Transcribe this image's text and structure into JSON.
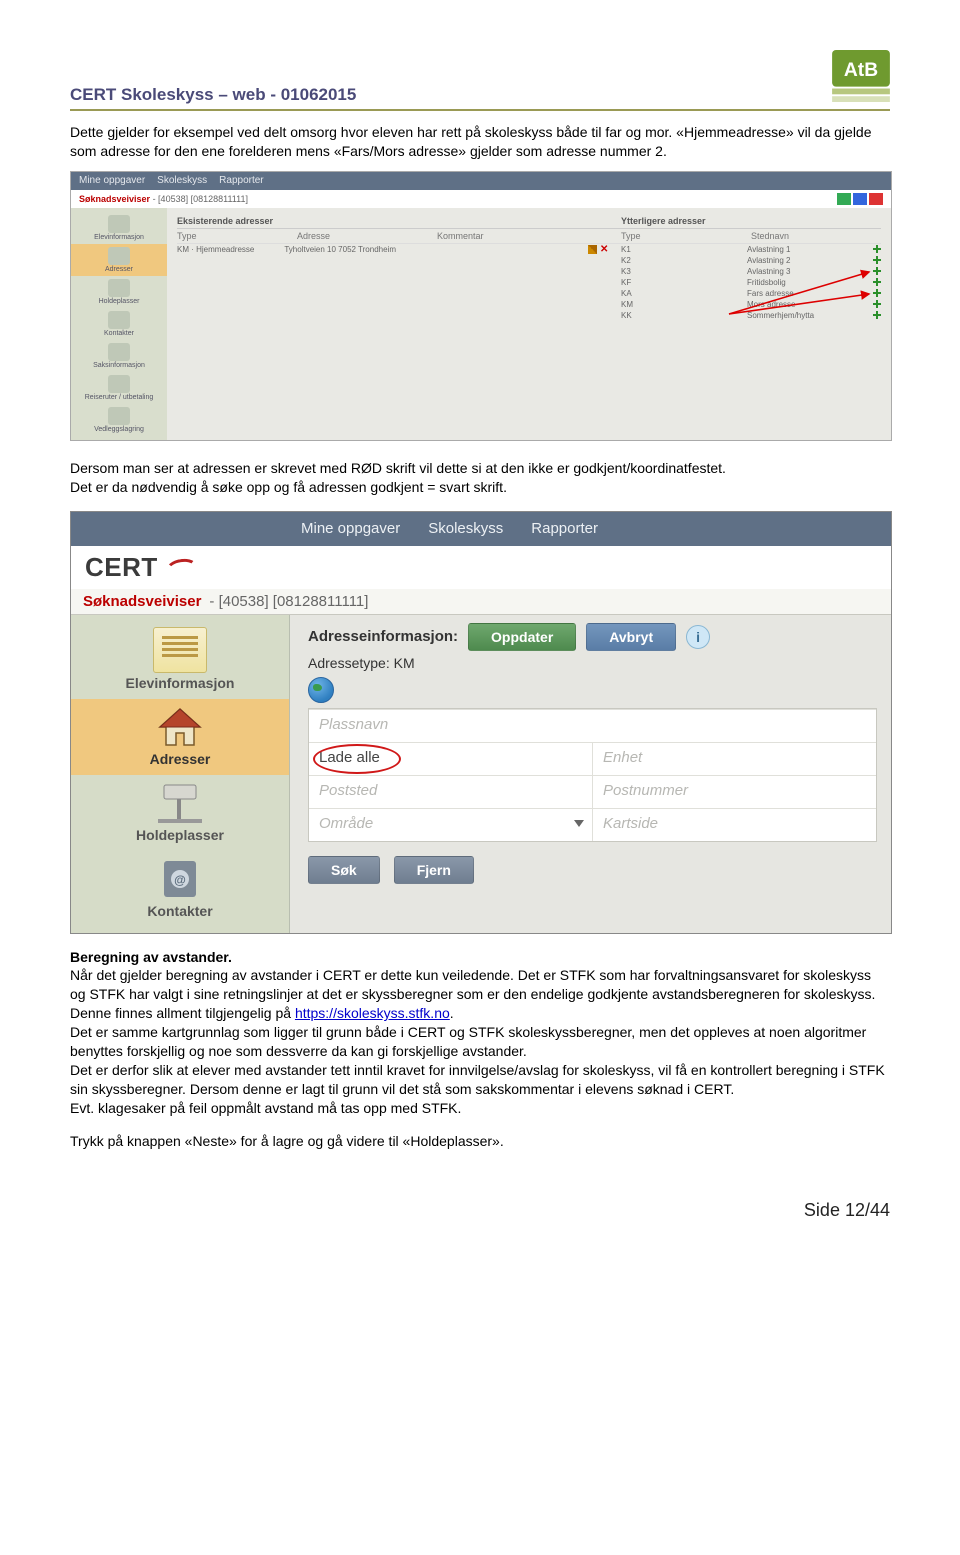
{
  "header": {
    "title": "CERT Skoleskyss – web - 01062015"
  },
  "para1": "Dette gjelder for eksempel ved delt omsorg hvor eleven har rett på skoleskyss både til far og mor. «Hjemmeadresse» vil da gjelde som adresse for den ene forelderen mens «Fars/Mors adresse» gjelder som adresse nummer 2.",
  "shot1": {
    "nav": [
      "Mine oppgaver",
      "Skoleskyss",
      "Rapporter"
    ],
    "subLabel": "Søknadsveiviser",
    "subId": "- [40538] [08128811111]",
    "side": [
      "Elevinformasjon",
      "Adresser",
      "Holdeplasser",
      "Kontakter",
      "Saksinformasjon",
      "Reiseruter / utbetaling",
      "Vedleggslagring"
    ],
    "leftHeader1": "Eksisterende adresser",
    "hType": "Type",
    "hAddr": "Adresse",
    "hKom": "Kommentar",
    "rightHeader": "Ytterligere adresser",
    "hType2": "Type",
    "hSted": "Stednavn",
    "row1a": "KM · Hjemmeadresse",
    "row1b": "Tyholtveien 10  7052 Trondheim",
    "rrows": [
      {
        "a": "K1",
        "b": "Avlastning 1"
      },
      {
        "a": "K2",
        "b": "Avlastning 2"
      },
      {
        "a": "K3",
        "b": "Avlastning 3"
      },
      {
        "a": "KF",
        "b": "Fritidsbolig"
      },
      {
        "a": "KA",
        "b": "Fars adresse"
      },
      {
        "a": "KM",
        "b": "Mors adresse"
      },
      {
        "a": "KK",
        "b": "Sommerhjem/hytta"
      }
    ]
  },
  "para2": "Dersom man ser at adressen er skrevet med RØD skrift vil dette si at den ikke er godkjent/koordinatfestet.\nDet er da nødvendig å søke opp og få adressen godkjent = svart skrift.",
  "shot2": {
    "nav": [
      "Mine oppgaver",
      "Skoleskyss",
      "Rapporter"
    ],
    "brand": "CERT",
    "subLabel": "Søknadsveiviser",
    "subId": "- [40538] [08128811111]",
    "side": [
      "Elevinformasjon",
      "Adresser",
      "Holdeplasser",
      "Kontakter"
    ],
    "titleLabel": "Adresseinformasjon:",
    "btnUpdate": "Oppdater",
    "btnCancel": "Avbryt",
    "subline": "Adressetype: KM",
    "cells": {
      "plass": "Plassnavn",
      "ladeVal": "Lade alle",
      "enhet": "Enhet",
      "poststed": "Poststed",
      "postnr": "Postnummer",
      "omrade": "Område",
      "kartside": "Kartside"
    },
    "btnSearch": "Søk",
    "btnClear": "Fjern"
  },
  "h2": "Beregning av avstander.",
  "body1": "Når det gjelder beregning av avstander i CERT er dette kun veiledende. Det er STFK som har forvaltningsansvaret for skoleskyss og STFK har valgt i sine retningslinjer at det er skyssberegner som er den endelige godkjente avstandsberegneren for skoleskyss.",
  "body2a": "Denne finnes allment tilgjengelig på ",
  "linkText": "https://skoleskyss.stfk.no",
  "body2b": ".",
  "body3": "Det er samme kartgrunnlag som ligger til grunn både i CERT og STFK skoleskyssberegner, men det oppleves at noen algoritmer benyttes forskjellig og noe som dessverre da kan gi forskjellige avstander.",
  "body4": "Det er derfor slik at elever med avstander tett inntil kravet for innvilgelse/avslag for skoleskyss, vil få en kontrollert beregning i STFK sin skyssberegner. Dersom denne er lagt til grunn vil det stå som sakskommentar i elevens søknad i CERT.",
  "body5": "Evt. klagesaker på feil oppmålt avstand må tas opp med STFK.",
  "body6": "Trykk på knappen «Neste» for å lagre og gå videre til «Holdeplasser».",
  "footer": "Side 12/44"
}
